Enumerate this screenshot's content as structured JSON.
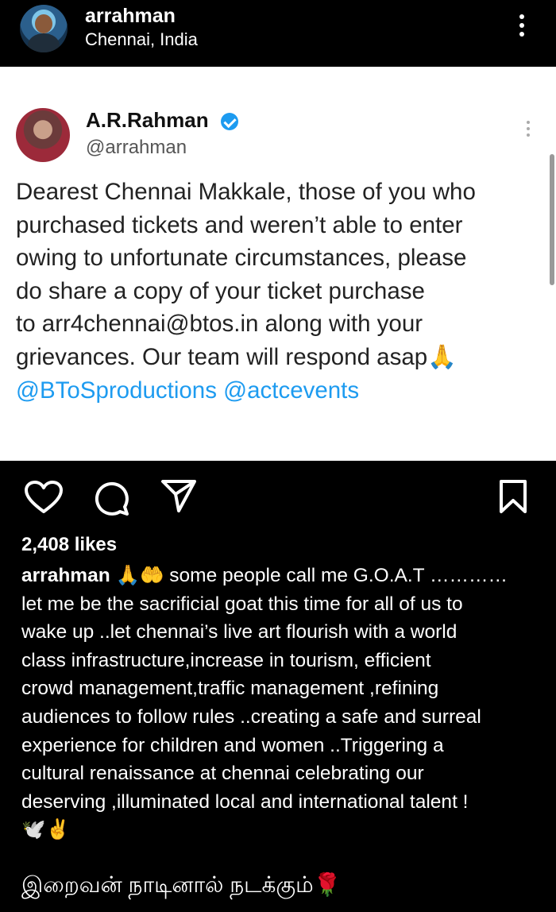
{
  "header": {
    "username": "arrahman",
    "location": "Chennai, India"
  },
  "tweet": {
    "name": "A.R.Rahman",
    "handle": "@arrahman",
    "lines": [
      "Dearest Chennai Makkale, those of you who",
      "purchased tickets and weren’t able to enter",
      "owing to unfortunate circumstances, please",
      "do share a copy of your ticket purchase",
      "to arr4chennai@btos.in along with your",
      "grievances. Our team will respond asap🙏"
    ],
    "mentions": "@BToSproductions @actcevents"
  },
  "post": {
    "likes": "2,408 likes",
    "caption_user": "arrahman",
    "caption_lines": [
      " 🙏🤲 some people call me G.O.A.T …………",
      "let me be the sacrificial goat this time for all of us to",
      "wake up ..let chennai’s live art flourish with a world",
      "class  infrastructure,increase in tourism, efficient",
      "crowd management,traffic management ,refining",
      "audiences to follow rules ..creating a safe and surreal",
      "experience for children and women ..Triggering a",
      "cultural renaissance at chennai celebrating our",
      "deserving ,illuminated  local and international talent !",
      "🕊️✌️"
    ],
    "tamil_line": "இறைவன் நாடினால் நடக்கும்🌹"
  },
  "icons": [
    "more-options-icon",
    "like-icon",
    "comment-icon",
    "share-icon",
    "bookmark-icon",
    "verified-icon"
  ]
}
